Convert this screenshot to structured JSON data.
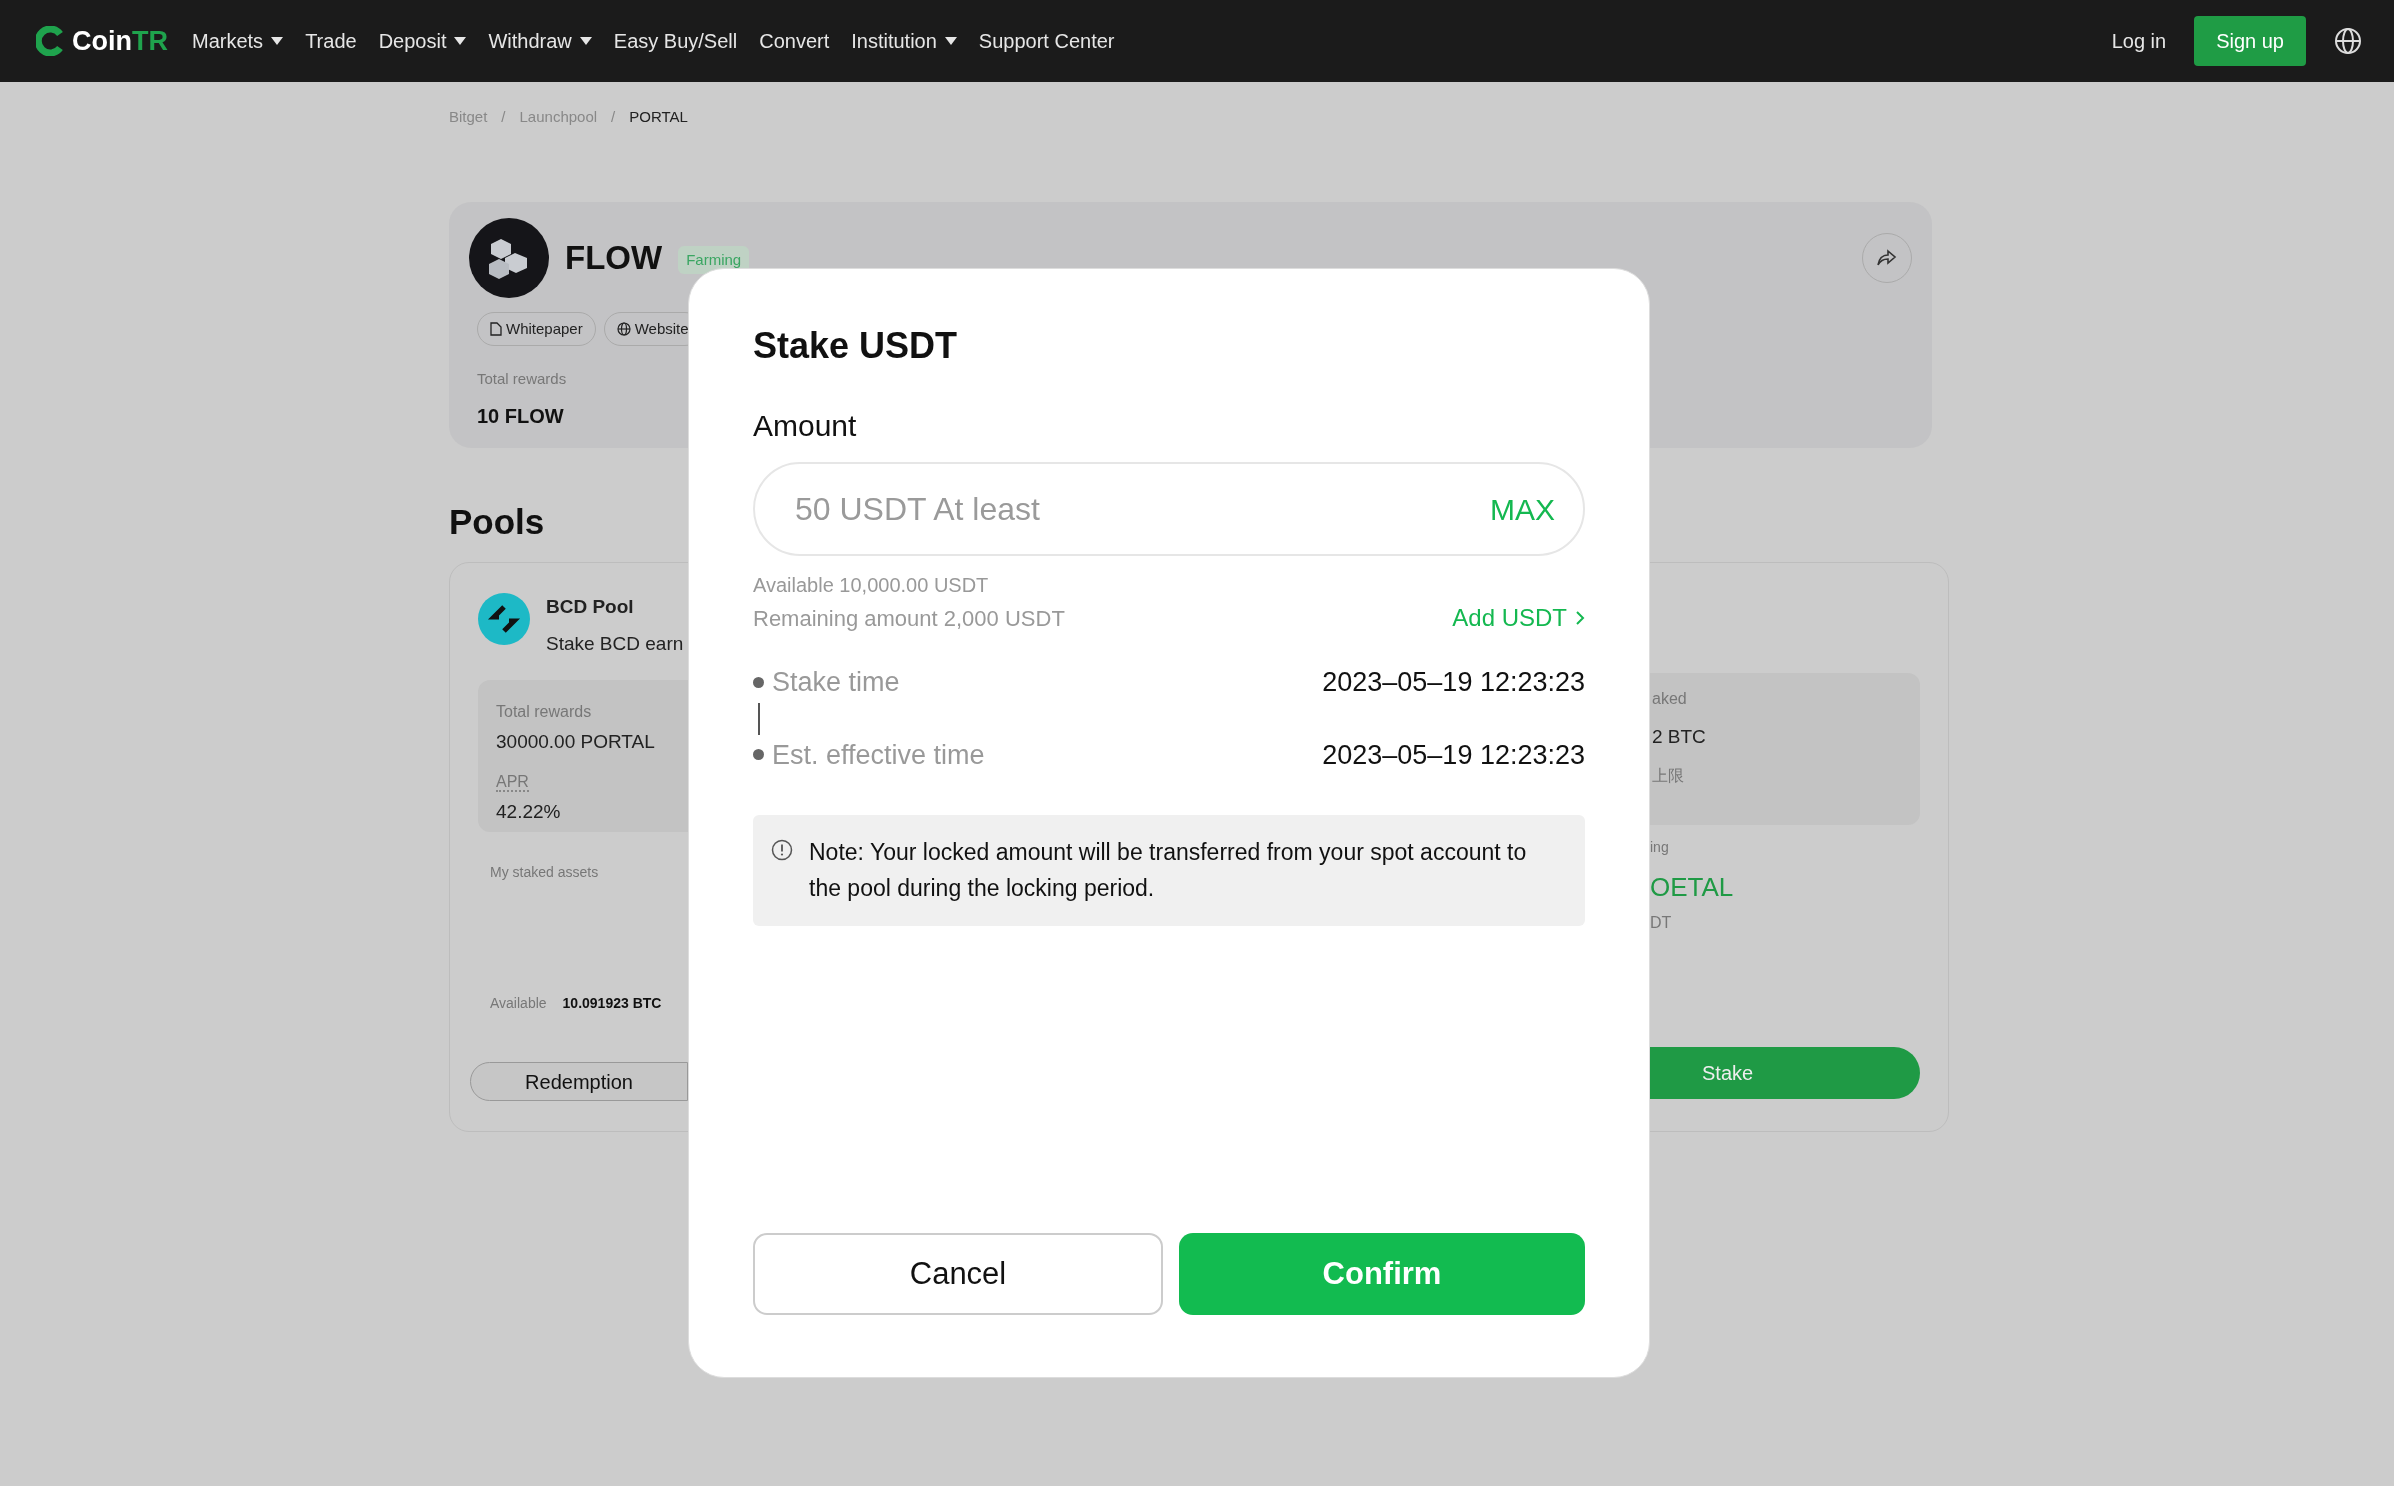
{
  "navbar": {
    "logo": {
      "text_main": "Coin",
      "text_accent": "TR"
    },
    "menu": [
      {
        "label": "Markets",
        "dropdown": true
      },
      {
        "label": "Trade",
        "dropdown": false
      },
      {
        "label": "Deposit",
        "dropdown": true
      },
      {
        "label": "Withdraw",
        "dropdown": true
      },
      {
        "label": "Easy Buy/Sell",
        "dropdown": false
      },
      {
        "label": "Convert",
        "dropdown": false
      },
      {
        "label": "Institution",
        "dropdown": true
      },
      {
        "label": "Support Center",
        "dropdown": false
      }
    ],
    "login": "Log in",
    "signup": "Sign up"
  },
  "breadcrumb_separator": "/",
  "breadcrumb": [
    {
      "label": "Bitget",
      "current": false
    },
    {
      "label": "Launchpool",
      "current": false
    },
    {
      "label": "PORTAL",
      "current": true
    }
  ],
  "project": {
    "name": "FLOW",
    "status": "Farming",
    "links": [
      {
        "kind": "document",
        "label": "Whitepaper"
      },
      {
        "kind": "globe",
        "label": "Website"
      }
    ],
    "total_rewards_label": "Total rewards",
    "total_rewards": "10 FLOW"
  },
  "pools_title": "Pools",
  "pool": {
    "name": "BCD Pool",
    "subtitle": "Stake BCD earn",
    "total_rewards_label": "Total rewards",
    "total_rewards": "30000.00 PORTAL",
    "apr_label": "APR",
    "apr": "42.22%",
    "staked_label": "My staked assets",
    "available_label": "Available",
    "available": "10.091923 BTC",
    "redeem": "Redemption",
    "right_stats": [
      "aked",
      "2 BTC",
      "上限"
    ],
    "right_remaining_label": "ing",
    "right_remaining": "OETAL",
    "right_unit": "DT",
    "stake": "Stake"
  },
  "modal": {
    "title": "Stake USDT",
    "amount_label": "Amount",
    "placeholder": "50 USDT At least",
    "max": "MAX",
    "available": "Available 10,000.00 USDT",
    "remaining": "Remaining amount  2,000 USDT",
    "add": "Add USDT",
    "timeline": [
      {
        "label": "Stake time",
        "value": "2023–05–19 12:23:23"
      },
      {
        "label": "Est. effective time",
        "value": "2023–05–19 12:23:23"
      }
    ],
    "note": "Note: Your locked amount will be transferred from your spot account to the pool during the locking period.",
    "cancel": "Cancel",
    "confirm": "Confirm"
  }
}
